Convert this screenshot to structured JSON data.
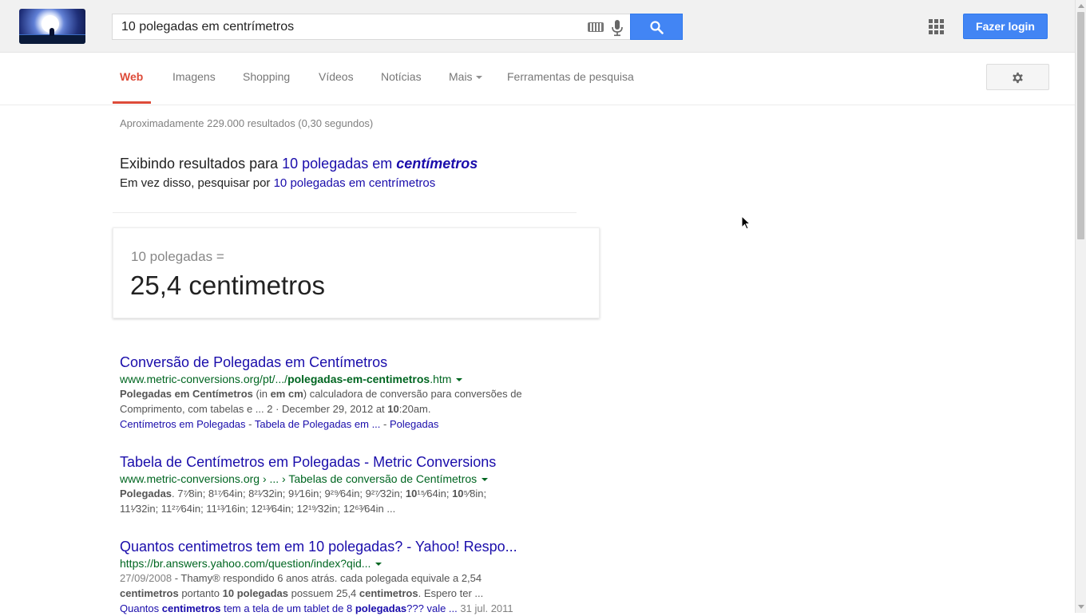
{
  "header": {
    "logo_alt": "Google Doodle",
    "search_query": "10 polegadas em centrímetros",
    "login_label": "Fazer login"
  },
  "nav": {
    "tabs": [
      {
        "label": "Web",
        "active": true
      },
      {
        "label": "Imagens"
      },
      {
        "label": "Shopping"
      },
      {
        "label": "Vídeos"
      },
      {
        "label": "Notícias"
      },
      {
        "label": "Mais"
      },
      {
        "label": "Ferramentas de pesquisa"
      }
    ]
  },
  "stats": "Aproximadamente 229.000 resultados (0,30 segundos)",
  "spelling": {
    "showing_prefix": "Exibindo resultados para",
    "corrected_plain": "10 polegadas em",
    "corrected_bold": "centímetros",
    "instead_prefix": "Em vez disso, pesquisar por",
    "original_query": "10 polegadas em centrímetros"
  },
  "conversion": {
    "lhs": "10 polegadas =",
    "rhs": "25,4 centimetros"
  },
  "results": [
    {
      "title": "Conversão de Polegadas em Centímetros",
      "url_plain": "www.metric-conversions.org/pt/.../",
      "url_bold": "polegadas-em-centimetros",
      "url_suffix": ".htm",
      "snippet_b1": "Polegadas em Centímetros",
      "snippet_t1": " (in ",
      "snippet_b2": "em cm",
      "snippet_t2": ") calculadora de conversão para conversões de Comprimento, com tabelas e ... 2 · December 29, 2012 at ",
      "snippet_b3": "10",
      "snippet_t3": ":20am.",
      "links": [
        "Centímetros em Polegadas",
        "Tabela de Polegadas em ...",
        "Polegadas"
      ]
    },
    {
      "title": "Tabela de Centímetros em Polegadas - Metric Conversions",
      "url": "www.metric-conversions.org › ... › Tabelas de conversão de Centímetros",
      "snippet_b1": "Polegadas",
      "fractions_line1": ". 7⁷⁄8in; 8¹⁷⁄64in; 8²¹⁄32in; 9¹⁄16in; 9²⁹⁄64in; 9²⁷⁄32in; ",
      "bold_mid1": "10",
      "frac_mid1": "¹⁵⁄64in; ",
      "bold_mid2": "10",
      "frac_mid2": "⁵⁄8in;",
      "fractions_line2": "11¹⁄32in; 11²⁷⁄64in; 11¹³⁄16in; 12¹³⁄64in; 12¹⁹⁄32in; 12⁶³⁄64in ..."
    },
    {
      "title": "Quantos centimetros tem em 10 polegadas? - Yahoo! Respo...",
      "url": "https://br.answers.yahoo.com/question/index?qid...",
      "date": "27/09/2008",
      "snippet_t1": " - Thamy® respondido 6 anos atrás. cada polegada equivale a 2,54 ",
      "snippet_b1": "centimetros",
      "snippet_t2": " portanto ",
      "snippet_b2": "10 polegadas",
      "snippet_t3": " possuem 25,4 ",
      "snippet_b3": "centimetros",
      "snippet_t4": ". Espero ter ...",
      "sub_t1": "Quantos ",
      "sub_b1": "centimetros",
      "sub_t2": " tem a tela de um tablet de 8 ",
      "sub_b2": "polegadas",
      "sub_t3": "??? vale ...",
      "sub_date": "31 jul. 2011"
    }
  ],
  "colors": {
    "brand_blue": "#4285f4",
    "active_tab_red": "#dd4b39",
    "link_blue": "#1a0dab",
    "url_green": "#006621"
  }
}
